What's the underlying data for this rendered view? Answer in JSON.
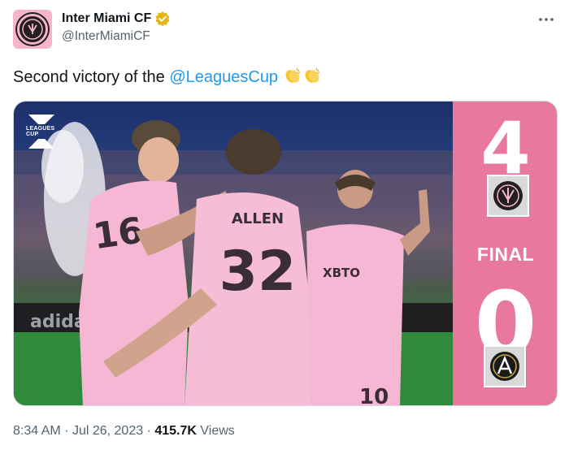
{
  "author": {
    "display_name": "Inter Miami CF",
    "handle": "@InterMiamiCF"
  },
  "tweet": {
    "text_prefix": "Second victory of the ",
    "mention": "@LeaguesCup",
    "emojis": [
      "clapping-hands",
      "clapping-hands"
    ]
  },
  "media": {
    "logo_text": "LEAGUES CUP",
    "jersey_name": "ALLEN",
    "jersey_number_front": "32",
    "jersey_number_left": "16",
    "jersey_number_bottom": "10",
    "sponsor": "XBTO",
    "scoreboard": {
      "home_score": "4",
      "status": "FINAL",
      "away_score": "0",
      "home_crest": "inter-miami-crest",
      "away_crest": "atlanta-united-crest",
      "background_color": "#e8789e"
    }
  },
  "meta": {
    "time": "8:34 AM",
    "separator": "·",
    "date": "Jul 26, 2023",
    "views_count": "415.7K",
    "views_label": "Views"
  },
  "colors": {
    "link": "#1d9bf0",
    "verified": "#e2b719",
    "kit_pink": "#f5b7d4"
  }
}
